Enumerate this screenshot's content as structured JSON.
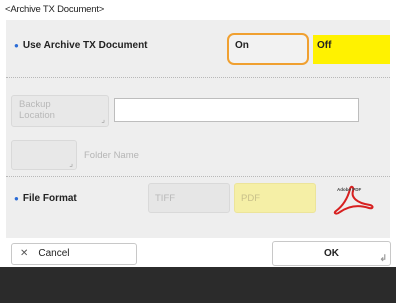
{
  "window": {
    "title": "<Archive TX Document>"
  },
  "use_archive": {
    "label": "Use Archive TX Document",
    "on_label": "On",
    "off_label": "Off",
    "selected": "Off"
  },
  "backup_location": {
    "label_line1": "Backup",
    "label_line2": "Location",
    "value": ""
  },
  "folder": {
    "label": "Folder Name"
  },
  "file_format": {
    "label": "File Format",
    "options": [
      "TIFF",
      "PDF"
    ],
    "selected": "PDF",
    "icon_text": "Adobe PDF"
  },
  "footer": {
    "cancel_label": "Cancel",
    "ok_label": "OK"
  },
  "colors": {
    "selected": "#fff200",
    "focus": "#f0a030",
    "bullet": "#2a6bd6"
  }
}
